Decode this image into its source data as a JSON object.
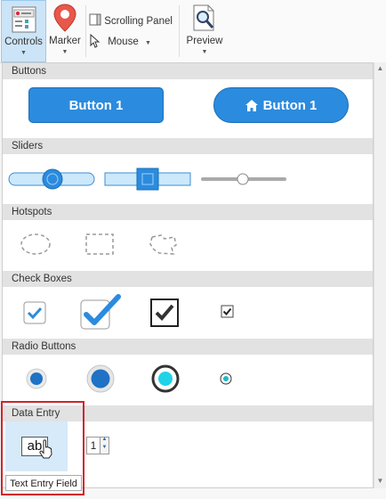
{
  "ribbon": {
    "controls": "Controls",
    "marker": "Marker",
    "scrolling_panel": "Scrolling Panel",
    "mouse": "Mouse",
    "preview": "Preview"
  },
  "sections": {
    "buttons": "Buttons",
    "sliders": "Sliders",
    "hotspots": "Hotspots",
    "check_boxes": "Check Boxes",
    "radio_buttons": "Radio Buttons",
    "data_entry": "Data Entry"
  },
  "buttons": {
    "button1": "Button 1",
    "button2": "Button 1"
  },
  "data_entry": {
    "text_icon": "ab",
    "spinner_value": "1"
  },
  "tooltip": "Text Entry Field",
  "colors": {
    "accent": "#2b8bde",
    "active_tab": "#cce4f7",
    "highlight_border": "#d2232a"
  }
}
